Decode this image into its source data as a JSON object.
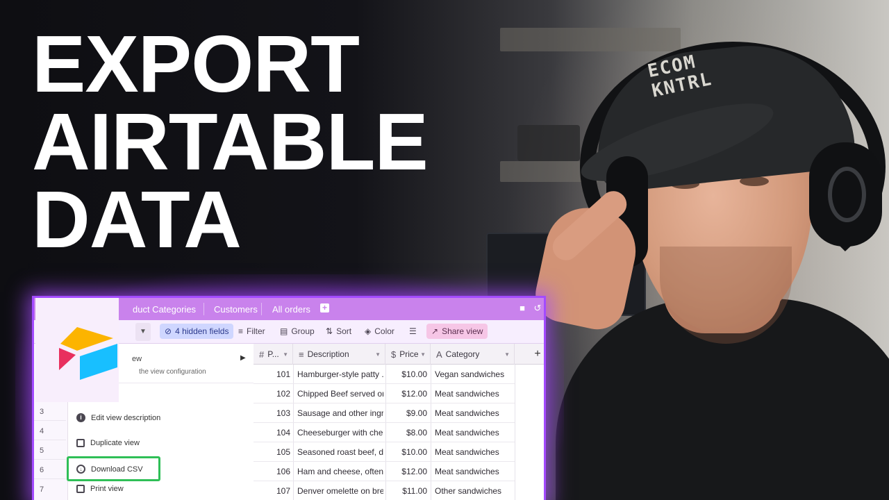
{
  "headline": {
    "line1": "EXPORT",
    "line2": "AIRTABLE",
    "line3": "DATA"
  },
  "cap_text": {
    "line1": "ECOM",
    "line2": "KNTRL"
  },
  "app": {
    "tabs": [
      "duct Categories",
      "Customers",
      "All orders"
    ],
    "toolbar": {
      "hidden_fields": "4 hidden fields",
      "filter": "Filter",
      "group": "Group",
      "sort": "Sort",
      "color": "Color",
      "share": "Share view"
    },
    "columns": {
      "id": "P...",
      "description": "Description",
      "price": "Price",
      "category": "Category"
    },
    "rows": [
      {
        "id": "101",
        "description": "Hamburger-style patty ...",
        "price": "$10.00",
        "category": "Vegan sandwiches"
      },
      {
        "id": "102",
        "description": "Chipped Beef served on...",
        "price": "$12.00",
        "category": "Meat sandwiches"
      },
      {
        "id": "103",
        "description": "Sausage and other ingr...",
        "price": "$9.00",
        "category": "Meat sandwiches"
      },
      {
        "id": "104",
        "description": "Cheeseburger with che...",
        "price": "$8.00",
        "category": "Meat sandwiches"
      },
      {
        "id": "105",
        "description": "Seasoned roast beef, dr...",
        "price": "$10.00",
        "category": "Meat sandwiches"
      },
      {
        "id": "106",
        "description": "Ham and cheese, often ...",
        "price": "$12.00",
        "category": "Meat sandwiches"
      },
      {
        "id": "107",
        "description": "Denver omelette on bre...",
        "price": "$11.00",
        "category": "Other sandwiches"
      }
    ],
    "row_numbers": [
      "3",
      "4",
      "5",
      "6",
      "7"
    ],
    "menu": {
      "top_text": "ew",
      "top_subtext": "the view configuration",
      "edit_description": "Edit view description",
      "duplicate": "Duplicate view",
      "download_csv": "Download CSV",
      "print": "Print view"
    },
    "colors": {
      "accent": "#a34bff",
      "tab_bar": "#c982ec",
      "highlight": "#2fbf57"
    }
  }
}
